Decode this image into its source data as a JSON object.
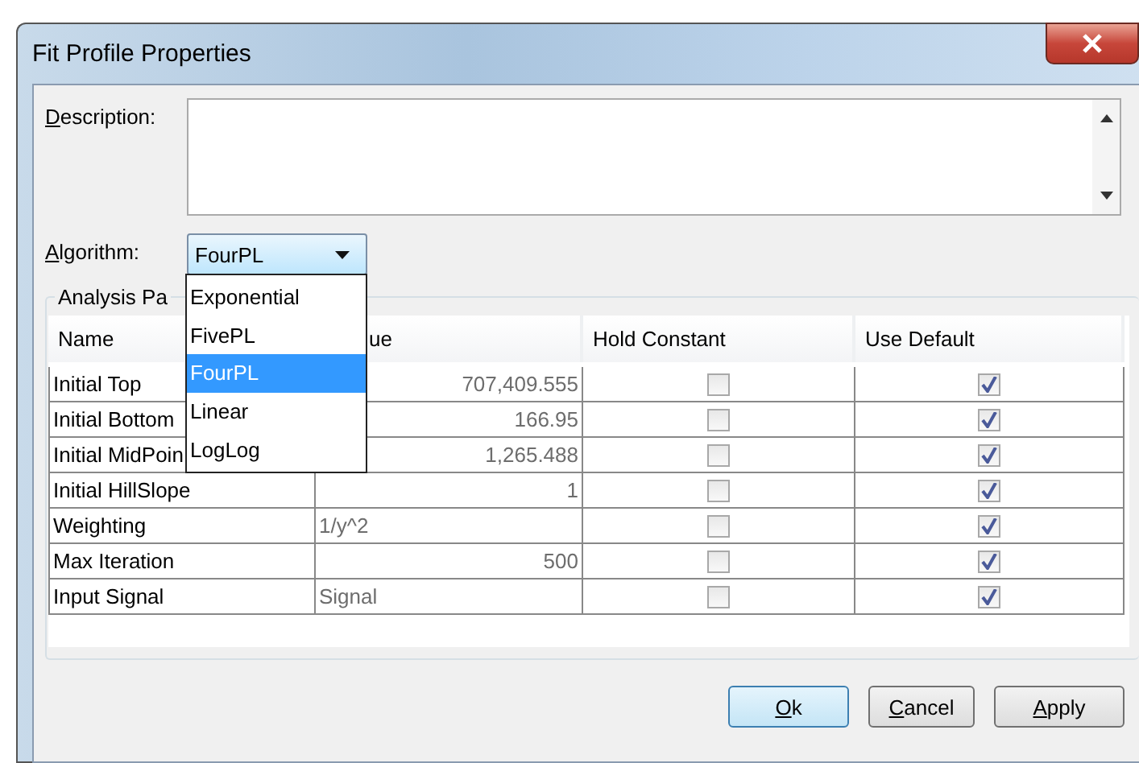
{
  "window": {
    "title": "Fit Profile Properties"
  },
  "description": {
    "label": "Description:"
  },
  "algorithm": {
    "label": "Algorithm:",
    "value": "FourPL",
    "open": true,
    "options": [
      {
        "label": "Exponential",
        "selected": false
      },
      {
        "label": "FivePL",
        "selected": false
      },
      {
        "label": "FourPL",
        "selected": true
      },
      {
        "label": "Linear",
        "selected": false
      },
      {
        "label": "LogLog",
        "selected": false
      }
    ]
  },
  "analysis_parameters": {
    "title": "Analysis Pa",
    "columns": [
      "Name",
      "ue",
      "Hold Constant",
      "Use Default"
    ],
    "rows": [
      {
        "name": "Initial Top",
        "value": "707,409.555",
        "kind": "number",
        "hold_constant": false,
        "use_default": true
      },
      {
        "name": "Initial Bottom",
        "value": "166.95",
        "kind": "number",
        "hold_constant": false,
        "use_default": true
      },
      {
        "name": "Initial MidPoin",
        "value": "1,265.488",
        "kind": "number",
        "hold_constant": false,
        "use_default": true
      },
      {
        "name": "Initial HillSlope",
        "value": "1",
        "kind": "number",
        "hold_constant": false,
        "use_default": true
      },
      {
        "name": "Weighting",
        "value": "1/y^2",
        "kind": "text",
        "hold_constant": false,
        "use_default": true
      },
      {
        "name": "Max Iteration",
        "value": "500",
        "kind": "number",
        "hold_constant": false,
        "use_default": true
      },
      {
        "name": "Input Signal",
        "value": "Signal",
        "kind": "text",
        "hold_constant": false,
        "use_default": true
      }
    ]
  },
  "buttons": [
    {
      "label": "Ok",
      "default": true
    },
    {
      "label": "Cancel",
      "default": false
    },
    {
      "label": "Apply",
      "default": false
    }
  ]
}
